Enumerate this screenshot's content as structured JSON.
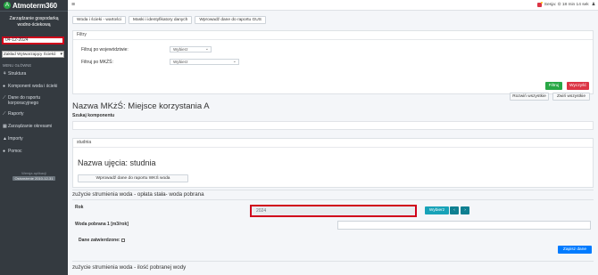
{
  "app": {
    "name": "Atmoterm360"
  },
  "sidebar": {
    "title_line1": "Zarządzanie gospodarką",
    "title_line2": "wodno-ściekową",
    "date_value": "04-12-2024",
    "zaklad_value": "Zakład Wytwarzający Ściekó",
    "menu_header": "MENU GŁÓWNE",
    "items": [
      {
        "label": "Struktura",
        "icon": "tree-icon"
      },
      {
        "label": "Komponent woda i ścieki",
        "icon": "drop-icon"
      },
      {
        "label": "Dane do raportu",
        "label2": "korporacyjnego",
        "icon": "chart-line-icon"
      },
      {
        "label": "Raporty",
        "icon": "chart-icon"
      },
      {
        "label": "Zarządzanie okresami",
        "icon": "calendar-icon"
      },
      {
        "label": "Importy",
        "icon": "upload-icon"
      },
      {
        "label": "Pomoc",
        "icon": "help-icon"
      }
    ],
    "footer_label": "Wersja aplikacji",
    "footer_version": "Ostrzeżenie 2010-12-31"
  },
  "topbar": {
    "session": "Sesja: ⊙ 18 min 14 sek"
  },
  "tabs": [
    "Woda i ścieki - wartości",
    "Maski i identyfikatory danych",
    "Wprowadź dane do raportu GUS"
  ],
  "filters": {
    "header": "Filtry",
    "woj_label": "Filtruj po województwie:",
    "woj_value": "Wybierz",
    "mkzs_label": "Filtruj po MKŻŚ:",
    "mkzs_value": "Wybierz",
    "filter_button": "Filtruj",
    "clear_button": "Wyczyść"
  },
  "toolbar": {
    "expand_all": "Rozwiń wszystkie",
    "collapse_all": "Zwiń wszystkie"
  },
  "main": {
    "title": "Nazwa MKżŚ: Miejsce korzystania A",
    "search_label": "Szukaj komponentu",
    "studnia_header": "studnia",
    "ujecie_title": "Nazwa ujęcia: studnia",
    "wko_button": "Wprowadź dane do raportu WKŚ woda",
    "section1_title": "zużycie strumienia woda - opłata stała- woda pobrana",
    "rok_label": "Rok",
    "rok_value": "2024",
    "select_button": "Wybierz",
    "prev_icon": "‹",
    "next_icon": "›",
    "woda_label": "Woda pobrana 1 [m3/rok]",
    "approved_label": "Dane zatwierdzone:",
    "save_button": "Zapisz dane",
    "section2_title": "zużycie strumienia woda - ilość pobranej wody"
  }
}
